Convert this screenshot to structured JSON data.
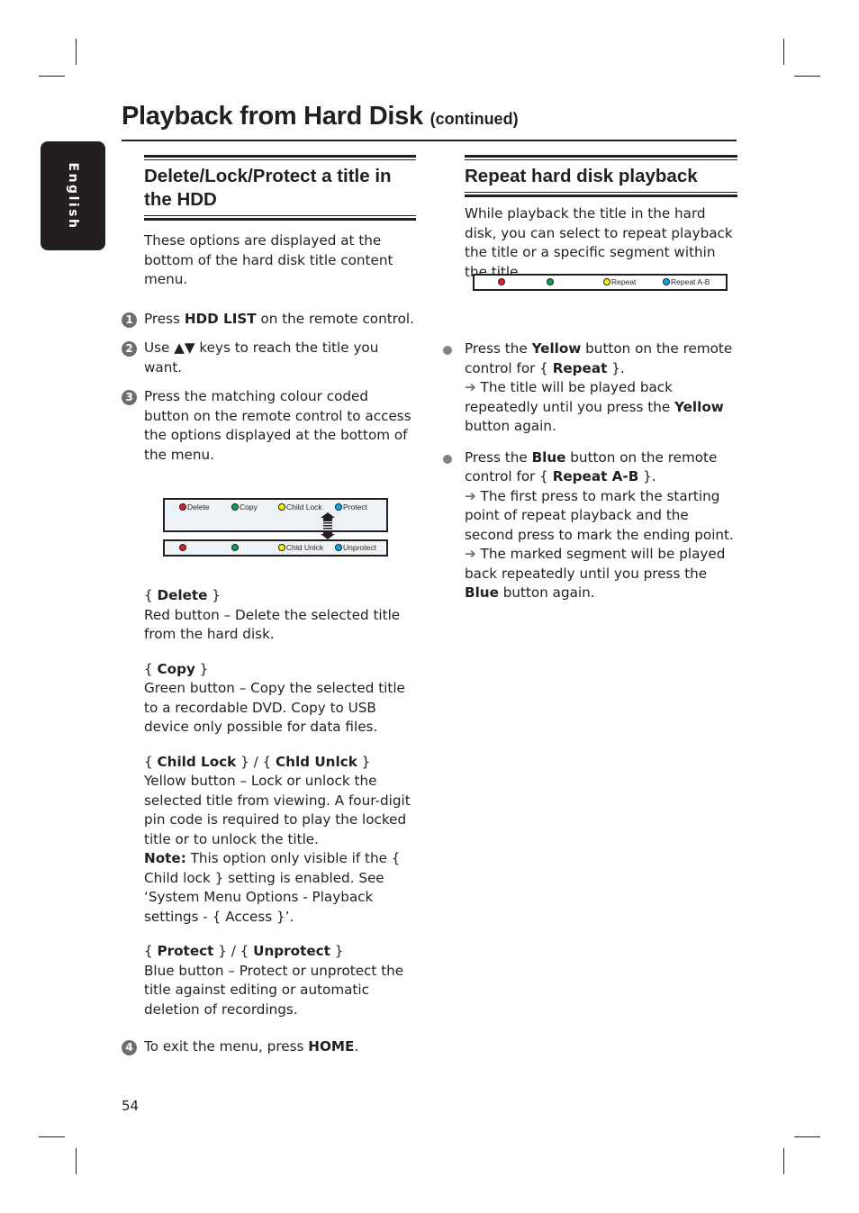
{
  "page": {
    "title": "Playback from Hard Disk",
    "title_suffix": "(continued)",
    "language_tab": "English",
    "page_number": "54"
  },
  "left_section": {
    "heading": "Delete/Lock/Protect a title in the HDD",
    "intro": "These options are displayed at the bottom of the hard disk title content menu.",
    "steps": [
      {
        "num": "1",
        "pre": "Press ",
        "bold": "HDD LIST",
        "post": " on the remote control."
      },
      {
        "num": "2",
        "pre": "Use ",
        "bold": "▲▼",
        "post": " keys to reach the title you want."
      },
      {
        "num": "3",
        "pre": "",
        "bold": "",
        "post": "Press the matching colour coded button on the remote control to access the options displayed at the bottom of the menu."
      },
      {
        "num": "4",
        "pre": "To exit the menu, press ",
        "bold": "HOME",
        "post": "."
      }
    ],
    "menu_top": {
      "items": [
        {
          "color_name": "red",
          "color": "#e31b23",
          "label": "Delete"
        },
        {
          "color_name": "green",
          "color": "#00a651",
          "label": "Copy"
        },
        {
          "color_name": "yellow",
          "color": "#fff200",
          "label": "Child Lock"
        },
        {
          "color_name": "blue",
          "color": "#00aeef",
          "label": "Protect"
        }
      ]
    },
    "menu_bottom": {
      "items": [
        {
          "color_name": "red",
          "color": "#e31b23",
          "label": ""
        },
        {
          "color_name": "green",
          "color": "#00a651",
          "label": ""
        },
        {
          "color_name": "yellow",
          "color": "#fff200",
          "label": "Chld Unlck"
        },
        {
          "color_name": "blue",
          "color": "#00aeef",
          "label": "Unprotect"
        }
      ]
    },
    "options": [
      {
        "title_parts": [
          {
            "text": "{ ",
            "bold": false
          },
          {
            "text": "Delete",
            "bold": true
          },
          {
            "text": " }",
            "bold": false
          }
        ],
        "body": "Red button – Delete the selected title from the hard disk."
      },
      {
        "title_parts": [
          {
            "text": "{ ",
            "bold": false
          },
          {
            "text": "Copy",
            "bold": true
          },
          {
            "text": " }",
            "bold": false
          }
        ],
        "body": "Green button – Copy the selected title to a recordable DVD.  Copy to USB device only possible for data files."
      },
      {
        "title_parts": [
          {
            "text": "{ ",
            "bold": false
          },
          {
            "text": "Child Lock",
            "bold": true
          },
          {
            "text": " } / { ",
            "bold": false
          },
          {
            "text": "Chld Unlck",
            "bold": true
          },
          {
            "text": " }",
            "bold": false
          }
        ],
        "body": "Yellow button – Lock or unlock the selected title from viewing.  A four-digit pin code is required to play the locked title or to unlock the title.",
        "note_label": "Note:",
        "note_text": "  This option only visible if the { Child lock } setting is enabled.  See ‘System Menu Options - Playback settings - { Access }’."
      },
      {
        "title_parts": [
          {
            "text": "{ ",
            "bold": false
          },
          {
            "text": "Protect",
            "bold": true
          },
          {
            "text": " } / { ",
            "bold": false
          },
          {
            "text": "Unprotect",
            "bold": true
          },
          {
            "text": " }",
            "bold": false
          }
        ],
        "body": "Blue button – Protect or unprotect the title against editing or automatic deletion of recordings."
      }
    ]
  },
  "right_section": {
    "heading": "Repeat hard disk playback",
    "intro": "While playback the title in the hard disk, you can select to repeat playback the title or a specific segment within the title.",
    "menu": {
      "items": [
        {
          "color_name": "red",
          "color": "#e31b23",
          "label": ""
        },
        {
          "color_name": "green",
          "color": "#00a651",
          "label": ""
        },
        {
          "color_name": "yellow",
          "color": "#fff200",
          "label": "Repeat"
        },
        {
          "color_name": "blue",
          "color": "#00aeef",
          "label": "Repeat A-B"
        }
      ]
    },
    "bullets": [
      {
        "line1_pre": "Press the ",
        "line1_bold": "Yellow",
        "line1_post": " button on the remote control for { ",
        "option_bold": "Repeat",
        "option_post": " }.",
        "results": [
          {
            "arrow": "➔",
            "pre": " The title will be played back repeatedly until you press the ",
            "bold": "Yellow",
            "post": " button again."
          }
        ]
      },
      {
        "line1_pre": "Press the ",
        "line1_bold": "Blue",
        "line1_post": " button on the remote control for { ",
        "option_bold": "Repeat A-B",
        "option_post": " }.",
        "results": [
          {
            "arrow": "➔",
            "pre": " The first press to mark the starting point of repeat playback and the second press to mark the ending point.",
            "bold": "",
            "post": ""
          },
          {
            "arrow": "➔",
            "pre": " The marked segment will be played back repeatedly until you press the ",
            "bold": "Blue",
            "post": " button again."
          }
        ]
      }
    ]
  }
}
